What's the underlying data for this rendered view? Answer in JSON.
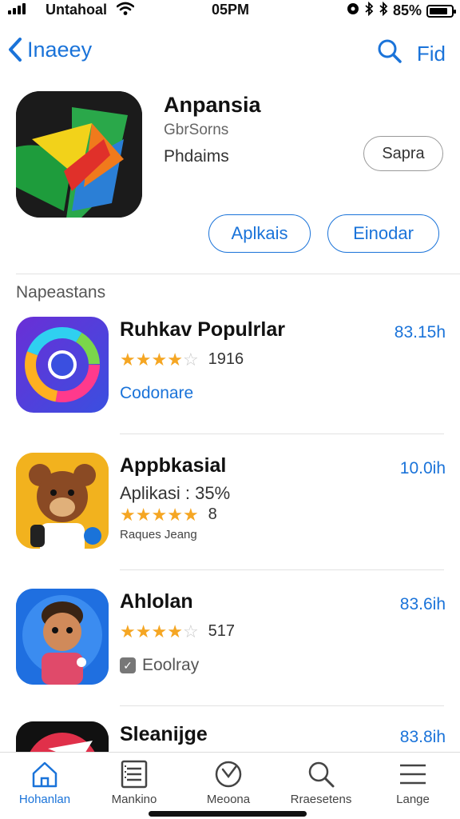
{
  "status_bar": {
    "carrier": "Untahoal",
    "time": "05PM",
    "battery": "85%"
  },
  "nav": {
    "back_label": "Inaeey",
    "action_label": "Fid"
  },
  "hero": {
    "title": "Anpansia",
    "subtitle": "GbrSorns",
    "category": "Phdaims",
    "side_button": "Sapra",
    "primary_button": "Aplkais",
    "secondary_button": "Einodar"
  },
  "section": {
    "title": "Napeastans"
  },
  "items": [
    {
      "title": "Ruhkav Populrlar",
      "size": "83.15h",
      "rating": 4.5,
      "rating_count": "1916",
      "link": "Codonare"
    },
    {
      "title": "Appbkasial",
      "size": "10.0ih",
      "subtitle": "Aplikasi : 35%",
      "rating": 5,
      "rating_count": "8",
      "tag": "Raques Jeang"
    },
    {
      "title": "Ahlolan",
      "size": "83.6ih",
      "rating": 3.5,
      "rating_count": "517",
      "check_label": "Eoolray"
    },
    {
      "title": "Sleanijge",
      "size": "83.8ih"
    }
  ],
  "tabs": [
    {
      "label": "Hohanlan",
      "icon": "home-icon",
      "active": true
    },
    {
      "label": "Mankino",
      "icon": "list-icon"
    },
    {
      "label": "Meoona",
      "icon": "clock-icon"
    },
    {
      "label": "Rraesetens",
      "icon": "search-icon"
    },
    {
      "label": "Lange",
      "icon": "menu-icon"
    }
  ],
  "colors": {
    "accent": "#1a73d9",
    "star": "#f5a623"
  }
}
